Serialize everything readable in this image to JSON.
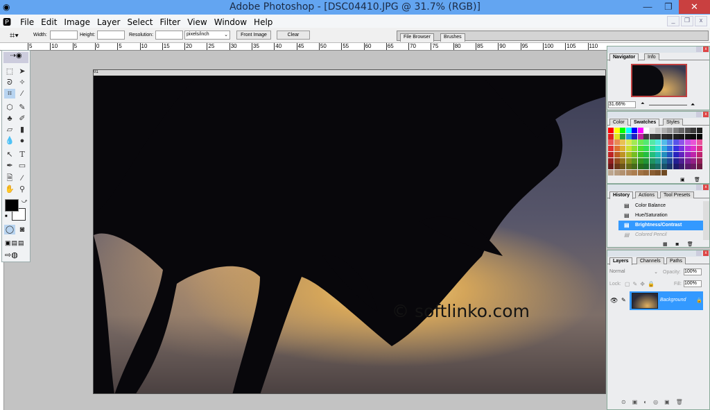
{
  "window": {
    "title": "Adobe Photoshop - [DSC04410.JPG @ 31.7% (RGB)]",
    "minimize": "—",
    "maximize": "❐",
    "close": "✕"
  },
  "menu": [
    "File",
    "Edit",
    "Image",
    "Layer",
    "Select",
    "Filter",
    "View",
    "Window",
    "Help"
  ],
  "mdi": {
    "minimize": "_",
    "restore": "❐",
    "close": "x"
  },
  "options": {
    "width_label": "Width:",
    "width_value": "",
    "height_label": "Height:",
    "height_value": "",
    "resolution_label": "Resolution:",
    "resolution_value": "",
    "units": "pixels/inch",
    "front_image": "Front Image",
    "clear": "Clear"
  },
  "well_tabs": [
    "File Browser",
    "Brushes"
  ],
  "ruler": [
    "5",
    "10",
    "5",
    "0",
    "5",
    "10",
    "15",
    "20",
    "25",
    "30",
    "35",
    "40",
    "45",
    "50",
    "55",
    "60",
    "65",
    "70",
    "75",
    "80",
    "85",
    "90",
    "95",
    "100",
    "105",
    "110"
  ],
  "document": {
    "watermark": "© softlinko.com",
    "title_marker": "01"
  },
  "navigator": {
    "tabs": [
      "Navigator",
      "Info"
    ],
    "zoom": "31.66%"
  },
  "swatches": {
    "tabs": [
      "Color",
      "Swatches",
      "Styles"
    ]
  },
  "history": {
    "tabs": [
      "History",
      "Actions",
      "Tool Presets"
    ],
    "items": [
      {
        "label": "Color Balance",
        "state": "normal"
      },
      {
        "label": "Hue/Saturation",
        "state": "normal"
      },
      {
        "label": "Brightness/Contrast",
        "state": "selected"
      },
      {
        "label": "Colored Pencil",
        "state": "undone"
      }
    ]
  },
  "layers": {
    "tabs": [
      "Layers",
      "Channels",
      "Paths"
    ],
    "blend_mode": "Normal",
    "opacity_label": "Opacity:",
    "opacity": "100%",
    "lock_label": "Lock:",
    "fill_label": "Fill:",
    "fill": "100%",
    "items": [
      {
        "name": "Background",
        "selected": true
      }
    ]
  },
  "colors": {
    "foreground": "#000000",
    "background": "#ffffff",
    "selection": "#3399ff",
    "titlebar": "#63a5f1"
  }
}
